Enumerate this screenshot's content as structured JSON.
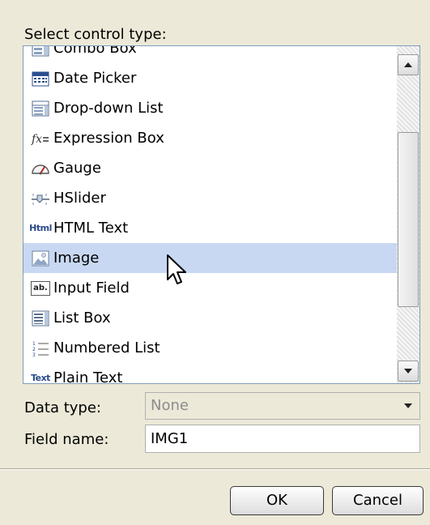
{
  "dialog": {
    "select_label": "Select control type:",
    "controls": [
      {
        "label": "Combo Box",
        "icon": "combo-box-icon"
      },
      {
        "label": "Date Picker",
        "icon": "calendar-icon"
      },
      {
        "label": "Drop-down List",
        "icon": "dropdown-list-icon"
      },
      {
        "label": "Expression Box",
        "icon": "expression-icon"
      },
      {
        "label": "Gauge",
        "icon": "gauge-icon"
      },
      {
        "label": "HSlider",
        "icon": "slider-icon"
      },
      {
        "label": "HTML Text",
        "icon": "html-icon",
        "icon_text": "Html"
      },
      {
        "label": "Image",
        "icon": "image-icon",
        "selected": true
      },
      {
        "label": "Input Field",
        "icon": "input-field-icon",
        "icon_text": "ab."
      },
      {
        "label": "List Box",
        "icon": "list-box-icon"
      },
      {
        "label": "Numbered List",
        "icon": "numbered-list-icon"
      },
      {
        "label": "Plain Text",
        "icon": "text-icon",
        "icon_text": "Text"
      }
    ],
    "data_type_label": "Data type:",
    "data_type_value": "None",
    "field_name_label": "Field name:",
    "field_name_value": "IMG1",
    "ok_label": "OK",
    "cancel_label": "Cancel"
  },
  "colors": {
    "background": "#ece9d8",
    "selection": "#c8d8f2",
    "listbox_border": "#7f9db9"
  }
}
